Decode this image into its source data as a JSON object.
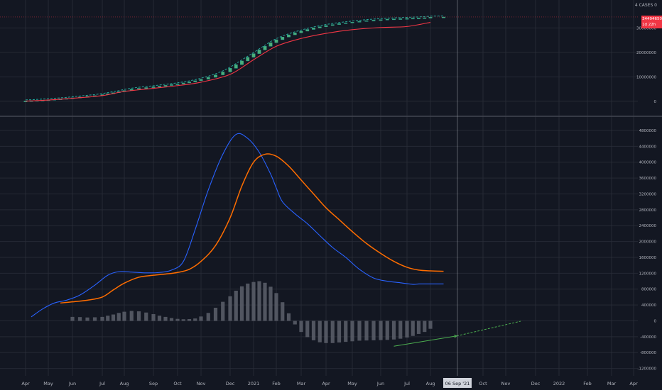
{
  "top_axis_header": "4 CASES 0",
  "price_tag": {
    "value": "34494650",
    "countdown": "1d 22h",
    "color": "#f23645"
  },
  "crosshair_date": "06 Sep '21",
  "colors": {
    "background": "#131722",
    "grid": "#2a2e39",
    "axis_text": "#b2b5be",
    "separator": "#434651",
    "candle_up": "#26a69a",
    "candle_fill": "#4caf78",
    "cum_ma": "#f23645",
    "fast_ma": "#2962ff",
    "slow_ma": "#ff6d00",
    "histogram": "#5d606b",
    "trend_line": "#4caf50"
  },
  "x_ticks": [
    "Apr",
    "May",
    "Jun",
    "Jul",
    "Aug",
    "Sep",
    "Oct",
    "Nov",
    "Dec",
    "2021",
    "Feb",
    "Mar",
    "Apr",
    "May",
    "Jun",
    "Jul",
    "Aug",
    "Oct",
    "Nov",
    "Dec",
    "2022",
    "Feb",
    "Mar",
    "Apr"
  ],
  "chart_data": [
    {
      "type": "line",
      "panel": "top",
      "ylim": [
        -5000000,
        40000000
      ],
      "y_ticks": [
        0,
        10000000,
        20000000,
        30000000
      ],
      "series": [
        {
          "name": "",
          "kind": "candles",
          "x": [
            0,
            0.25,
            0.5,
            0.75,
            1,
            1.25,
            1.5,
            1.75,
            2,
            2.25,
            2.5,
            2.75,
            3,
            3.25,
            3.5,
            3.75,
            4,
            4.25,
            4.5,
            4.75,
            5,
            5.25,
            5.5,
            5.75,
            6,
            6.25,
            6.5,
            6.75,
            7,
            7.25,
            7.5,
            7.75,
            8,
            8.25,
            8.5,
            8.75,
            9,
            9.25,
            9.5,
            9.75,
            10,
            10.25,
            10.5,
            10.75,
            11,
            11.25,
            11.5,
            11.75,
            12,
            12.25,
            12.5,
            12.75,
            13,
            13.25,
            13.5,
            13.75,
            14,
            14.25,
            14.5,
            14.75,
            15,
            15.25,
            15.5,
            15.75,
            16,
            16.25
          ],
          "values": [
            100000,
            200000,
            320000,
            450000,
            600000,
            780000,
            950000,
            1150000,
            1400000,
            1700000,
            2000000,
            2300000,
            2700000,
            3100000,
            3500000,
            3900000,
            4400000,
            4900000,
            5300000,
            5600000,
            5900000,
            6200000,
            6500000,
            6800000,
            7100000,
            7500000,
            7900000,
            8400000,
            9000000,
            9800000,
            10800000,
            12000000,
            13500000,
            15000000,
            16500000,
            18000000,
            19500000,
            21000000,
            22500000,
            24000000,
            25200000,
            26300000,
            27200000,
            28000000,
            28700000,
            29400000,
            30000000,
            30500000,
            31000000,
            31400000,
            31800000,
            32100000,
            32400000,
            32700000,
            33000000,
            33200000,
            33400000,
            33600000,
            33700000,
            33800000,
            33900000,
            34000000,
            34100000,
            34200000,
            34400000,
            34494650
          ]
        },
        {
          "name": "",
          "kind": "line",
          "x": [
            0,
            1,
            2,
            3,
            4,
            5,
            6,
            7,
            8,
            9,
            10,
            11,
            12,
            13,
            14,
            15,
            16
          ],
          "values": [
            50000,
            500000,
            1200000,
            2300000,
            4000000,
            5300000,
            6400000,
            7800000,
            11000000,
            17000000,
            22500000,
            25700000,
            27800000,
            29300000,
            30200000,
            30600000,
            32300000
          ]
        }
      ]
    },
    {
      "type": "line",
      "panel": "bottom",
      "ylim": [
        -1350000,
        5050000
      ],
      "y_ticks": [
        -1200000,
        -800000,
        -400000,
        0,
        400000,
        800000,
        1200000,
        1600000,
        2000000,
        2400000,
        2800000,
        3200000,
        3600000,
        4000000,
        4400000,
        4800000
      ],
      "series": [
        {
          "name": "",
          "kind": "line",
          "x": [
            0.25,
            0.75,
            1.25,
            1.75,
            2.25,
            2.75,
            3.25,
            3.75,
            4.25,
            4.75,
            5.25,
            5.75,
            6.25,
            6.75,
            7.25,
            7.75,
            8.25,
            8.75,
            9.25,
            9.75,
            10,
            10.25,
            10.75,
            11.25,
            11.75,
            12.25,
            12.75,
            13.25,
            13.75,
            14.25,
            14.75,
            15.25,
            15.5,
            15.75,
            16.25
          ],
          "values": [
            100000,
            300000,
            450000,
            520000,
            650000,
            900000,
            1150000,
            1240000,
            1230000,
            1210000,
            1220000,
            1280000,
            1500000,
            2300000,
            3300000,
            4200000,
            4700000,
            4600000,
            4250000,
            3700000,
            3350000,
            3000000,
            2700000,
            2450000,
            2150000,
            1850000,
            1600000,
            1300000,
            1080000,
            1000000,
            960000,
            920000,
            930000,
            930000,
            930000
          ]
        },
        {
          "name": "",
          "kind": "line",
          "x": [
            1.5,
            2,
            2.5,
            3,
            3.5,
            4,
            4.5,
            5,
            5.5,
            6,
            6.5,
            7,
            7.5,
            8,
            8.5,
            9,
            9.5,
            10,
            10.5,
            11,
            11.5,
            12,
            12.5,
            13,
            13.5,
            14,
            14.5,
            15,
            15.5,
            16,
            16.25
          ],
          "values": [
            450000,
            480000,
            520000,
            600000,
            780000,
            950000,
            1100000,
            1150000,
            1180000,
            1220000,
            1300000,
            1500000,
            1900000,
            2600000,
            3400000,
            4000000,
            4200000,
            4150000,
            3900000,
            3550000,
            3200000,
            2850000,
            2550000,
            2250000,
            1950000,
            1700000,
            1500000,
            1350000,
            1280000,
            1260000,
            1250000
          ]
        },
        {
          "name": "",
          "kind": "histogram",
          "x": [
            2,
            2.25,
            2.5,
            2.75,
            3,
            3.25,
            3.5,
            3.75,
            4,
            4.25,
            4.5,
            4.75,
            5,
            5.25,
            5.5,
            5.75,
            6,
            6.25,
            6.5,
            6.75,
            7,
            7.25,
            7.5,
            7.75,
            8,
            8.25,
            8.5,
            8.75,
            9,
            9.25,
            9.5,
            9.75,
            10,
            10.25,
            10.5,
            10.75,
            11,
            11.25,
            11.5,
            11.75,
            12,
            12.25,
            12.5,
            12.75,
            13,
            13.25,
            13.5,
            13.75,
            14,
            14.25,
            14.5,
            14.75,
            15,
            15.25,
            15.5,
            15.75,
            16
          ],
          "values": [
            100000,
            95000,
            85000,
            90000,
            100000,
            130000,
            160000,
            200000,
            230000,
            250000,
            240000,
            210000,
            170000,
            130000,
            100000,
            70000,
            50000,
            40000,
            45000,
            60000,
            110000,
            200000,
            330000,
            480000,
            620000,
            760000,
            870000,
            940000,
            980000,
            1000000,
            960000,
            860000,
            700000,
            470000,
            190000,
            -90000,
            -280000,
            -410000,
            -490000,
            -540000,
            -560000,
            -560000,
            -545000,
            -530000,
            -515000,
            -500000,
            -495000,
            -490000,
            -485000,
            -480000,
            -470000,
            -450000,
            -420000,
            -380000,
            -330000,
            -280000,
            -200000
          ]
        },
        {
          "name": "",
          "kind": "trend",
          "x": [
            14.5,
            16.5
          ],
          "values": [
            -640000,
            -380000
          ]
        },
        {
          "name": "",
          "kind": "trend-projection",
          "x": [
            16.5,
            18.5
          ],
          "values": [
            -380000,
            -10000
          ]
        }
      ]
    }
  ]
}
